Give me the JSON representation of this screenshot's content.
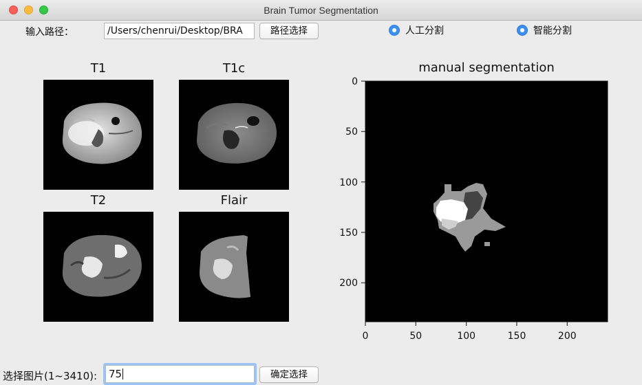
{
  "window": {
    "title": "Brain Tumor Segmentation"
  },
  "path_row": {
    "label": "输入路径：",
    "path_value": "/Users/chenrui/Desktop/BRA",
    "browse_button": "路径选择"
  },
  "mode_options": [
    {
      "label": "人工分割",
      "selected": true
    },
    {
      "label": "智能分割",
      "selected": true
    }
  ],
  "modality_images": [
    {
      "title": "T1",
      "icon": "brain-mri-t1"
    },
    {
      "title": "T1c",
      "icon": "brain-mri-t1c"
    },
    {
      "title": "T2",
      "icon": "brain-mri-t2"
    },
    {
      "title": "Flair",
      "icon": "brain-mri-flair"
    }
  ],
  "segmentation_plot": {
    "title": "manual segmentation",
    "x_ticks": [
      "0",
      "50",
      "100",
      "150",
      "200"
    ],
    "y_ticks": [
      "0",
      "50",
      "100",
      "150",
      "200"
    ],
    "x_range": [
      0,
      240
    ],
    "y_range": [
      0,
      240
    ],
    "background_color": "#000000",
    "tumor_colors": [
      "#ffffff",
      "#cfcfcf",
      "#9a9a9a",
      "#444444"
    ]
  },
  "image_select_row": {
    "label": "选择图片(1~3410):",
    "index_value": "75",
    "confirm_button": "确定选择"
  },
  "colors": {
    "radio_accent": "#3d8ff2",
    "window_background": "#ececec"
  }
}
